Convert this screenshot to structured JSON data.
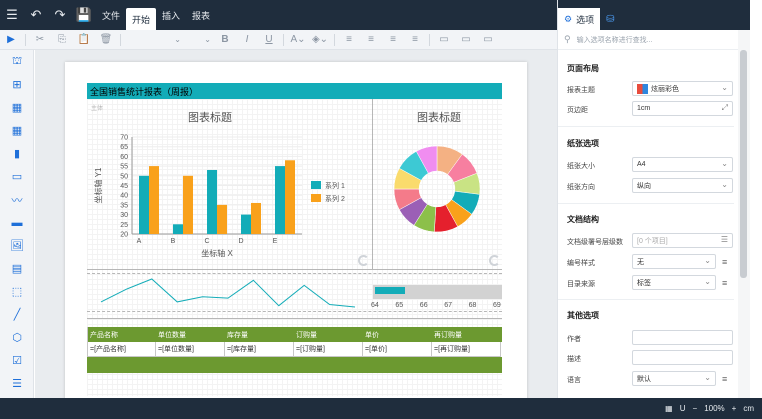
{
  "menubar": {
    "tabs": [
      {
        "label": "文件",
        "active": false
      },
      {
        "label": "开始",
        "active": true
      },
      {
        "label": "插入",
        "active": false
      },
      {
        "label": "报表",
        "active": false
      }
    ]
  },
  "toolbar": {
    "bold": "B",
    "italic": "I",
    "underline": "U"
  },
  "report": {
    "title": "全国销售统计报表（周报）",
    "theme_tag": "主体",
    "chart_title_left": "图表标题",
    "chart_title_right": "图表标题",
    "table_headers": [
      "产品名称",
      "单位数量",
      "库存量",
      "订购量",
      "单价",
      "再订购量"
    ],
    "table_row": [
      "=[产品名称]",
      "=[单位数量]",
      "=[库存量]",
      "=[订购量]",
      "=[单价]",
      "=[再订购量]"
    ],
    "progress_scale": [
      "64",
      "65",
      "66",
      "67",
      "68",
      "69"
    ],
    "progress_value": 64.5
  },
  "chart_data": [
    {
      "type": "bar",
      "title": "图表标题",
      "xlabel": "坐标轴 X",
      "ylabel": "坐标轴 Y1",
      "categories": [
        "A",
        "B",
        "C",
        "D",
        "E"
      ],
      "ylim": [
        20,
        70
      ],
      "yticks": [
        20,
        25,
        30,
        35,
        40,
        45,
        50,
        55,
        60,
        65,
        70
      ],
      "series": [
        {
          "name": "系列 1",
          "values": [
            50,
            25,
            53,
            30,
            55
          ],
          "color": "#13acb8"
        },
        {
          "name": "系列 2",
          "values": [
            55,
            50,
            35,
            36,
            58
          ],
          "color": "#f9a11b"
        }
      ],
      "legend": "right"
    },
    {
      "type": "pie",
      "title": "图表标题",
      "donut": true,
      "values": [
        10,
        9,
        8,
        8,
        7,
        9,
        8,
        8,
        8,
        8,
        9,
        8
      ],
      "colors": [
        "#f4b183",
        "#f77fa0",
        "#c9e384",
        "#13acb8",
        "#f9a11b",
        "#e5202d",
        "#8cc04a",
        "#9b5fb6",
        "#f47b8a",
        "#fadb6c",
        "#3dc9d4",
        "#f08df0"
      ]
    },
    {
      "type": "line",
      "values": [
        10,
        20,
        28,
        10,
        14,
        13,
        27,
        7,
        23,
        8,
        6
      ],
      "color": "#13acb8"
    }
  ],
  "panel": {
    "tab_options": "选项",
    "search_placeholder": "输入选项名称进行查找...",
    "sections": {
      "layout": "页面布局",
      "paper": "纸张选项",
      "structure": "文档结构",
      "other": "其他选项"
    },
    "fields": {
      "theme_label": "报表主题",
      "theme_value": "炫丽彩色",
      "margin_label": "页边距",
      "margin_value": "1cm",
      "paper_size_label": "纸张大小",
      "paper_size_value": "A4",
      "orientation_label": "纸张方向",
      "orientation_value": "纵向",
      "doc_levels_label": "文档级署号层级数",
      "doc_levels_value": "[0 个项目]",
      "numbering_label": "编号样式",
      "numbering_value": "无",
      "toc_source_label": "目录来源",
      "toc_source_value": "标签",
      "author_label": "作者",
      "author_value": "",
      "desc_label": "描述",
      "desc_value": "",
      "lang_label": "语言",
      "lang_value": "默认"
    }
  },
  "status": {
    "zoom": "100%",
    "unit": "cm",
    "minus": "−",
    "plus": "+"
  }
}
